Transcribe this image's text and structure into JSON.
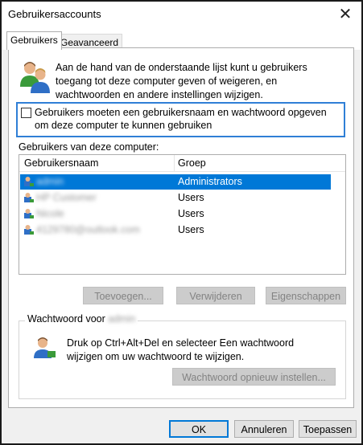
{
  "window": {
    "title": "Gebruikersaccounts",
    "close_glyph": "✕"
  },
  "tabs": [
    {
      "label": "Gebruikers",
      "active": true
    },
    {
      "label": "Geavanceerd",
      "active": false
    }
  ],
  "intro": {
    "icon": "users-icon",
    "text": "Aan de hand van de onderstaande lijst kunt u gebruikers toegang tot deze computer geven of weigeren, en wachtwoorden en andere instellingen wijzigen."
  },
  "require_login": {
    "label": "Gebruikers moeten een gebruikersnaam en wachtwoord opgeven om deze computer te kunnen gebruiken",
    "checked": false
  },
  "users_section": {
    "label": "Gebruikers van deze computer:",
    "columns": [
      "Gebruikersnaam",
      "Groep"
    ],
    "rows": [
      {
        "name": "admin",
        "group": "Administrators",
        "selected": true
      },
      {
        "name": "HP Customer",
        "group": "Users",
        "selected": false
      },
      {
        "name": "Nicole",
        "group": "Users",
        "selected": false
      },
      {
        "name": "4129780@outlook.com",
        "group": "Users",
        "selected": false
      }
    ]
  },
  "user_buttons": {
    "add": "Toevoegen...",
    "remove": "Verwijderen",
    "properties": "Eigenschappen"
  },
  "password_section": {
    "legend_prefix": "Wachtwoord voor",
    "legend_user": "admin",
    "text": "Druk op Ctrl+Alt+Del en selecteer Een wachtwoord wijzigen om uw wachtwoord te wijzigen.",
    "reset_button": "Wachtwoord opnieuw instellen..."
  },
  "dialog_buttons": {
    "ok": "OK",
    "cancel": "Annuleren",
    "apply": "Toepassen"
  },
  "colors": {
    "selection": "#0078d7",
    "focus_border": "#2f7fd6",
    "disabled_button": "#cccccc"
  }
}
